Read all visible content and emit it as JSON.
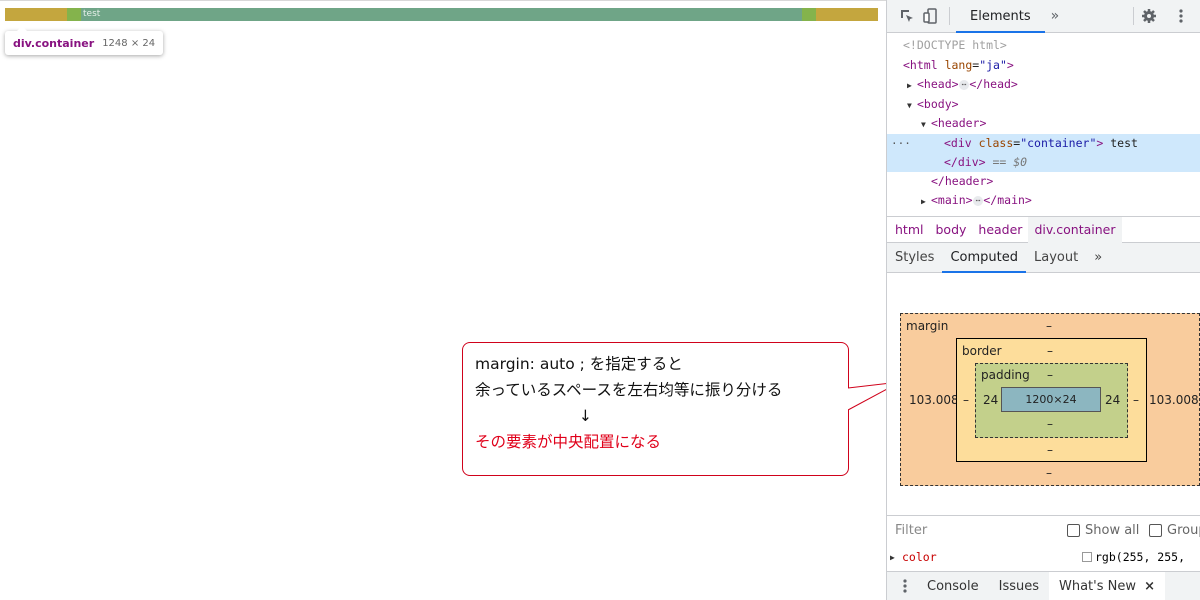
{
  "page": {
    "content_text": "test",
    "tooltip": {
      "name": "div.container",
      "size": "1248 × 24"
    }
  },
  "callout": {
    "line1": "margin: auto ; を指定すると",
    "line2": "余っているスペースを左右均等に振り分ける",
    "arrow": "↓",
    "line3": "その要素が中央配置になる"
  },
  "devtools": {
    "tabs": {
      "elements": "Elements",
      "more": "»"
    },
    "icons": [
      "inspect-icon",
      "device-toggle-icon",
      "gear-icon",
      "kebab-menu-icon"
    ],
    "dom": {
      "doctype": "<!DOCTYPE html>",
      "html_open_tag": "<html",
      "html_attr": "lang",
      "html_attr_val": "\"ja\"",
      "html_close": ">",
      "head": "<head>",
      "head_close": "</head>",
      "body": "<body>",
      "header": "<header>",
      "div_open": "<div",
      "div_attr": "class",
      "div_attr_val": "\"container\"",
      "div_open_end": ">",
      "div_text": "test",
      "div_close": "</div>",
      "eq_ref": "== $0",
      "header_close": "</header>",
      "main": "<main>",
      "main_close": "</main>",
      "ellipsis": "⋯",
      "dots": "···"
    },
    "breadcrumbs": [
      "html",
      "body",
      "header",
      "div.container"
    ],
    "subtabs": {
      "styles": "Styles",
      "computed": "Computed",
      "layout": "Layout",
      "more": "»"
    },
    "boxmodel": {
      "margin_label": "margin",
      "margin_top": "–",
      "margin_bottom": "–",
      "margin_left": "103.008",
      "margin_right": "103.008",
      "border_label": "border",
      "border_top": "–",
      "border_bottom": "–",
      "border_left": "–",
      "border_right": "–",
      "padding_label": "padding",
      "padding_top": "–",
      "padding_bottom": "–",
      "padding_left": "24",
      "padding_right": "24",
      "content": "1200×24"
    },
    "filter": {
      "placeholder": "Filter",
      "show_all": "Show all",
      "group": "Group"
    },
    "property": {
      "name": "color",
      "value": "rgb(255, 255,"
    },
    "drawer": {
      "console": "Console",
      "issues": "Issues",
      "whats_new": "What's New",
      "close": "×"
    }
  },
  "colors": {
    "margin": "#f9cc9d",
    "border": "#fddd9b",
    "padding": "#c3d08b",
    "content": "#8cb6c0",
    "callout_border": "#d0021b",
    "accent": "#1a73e8"
  }
}
